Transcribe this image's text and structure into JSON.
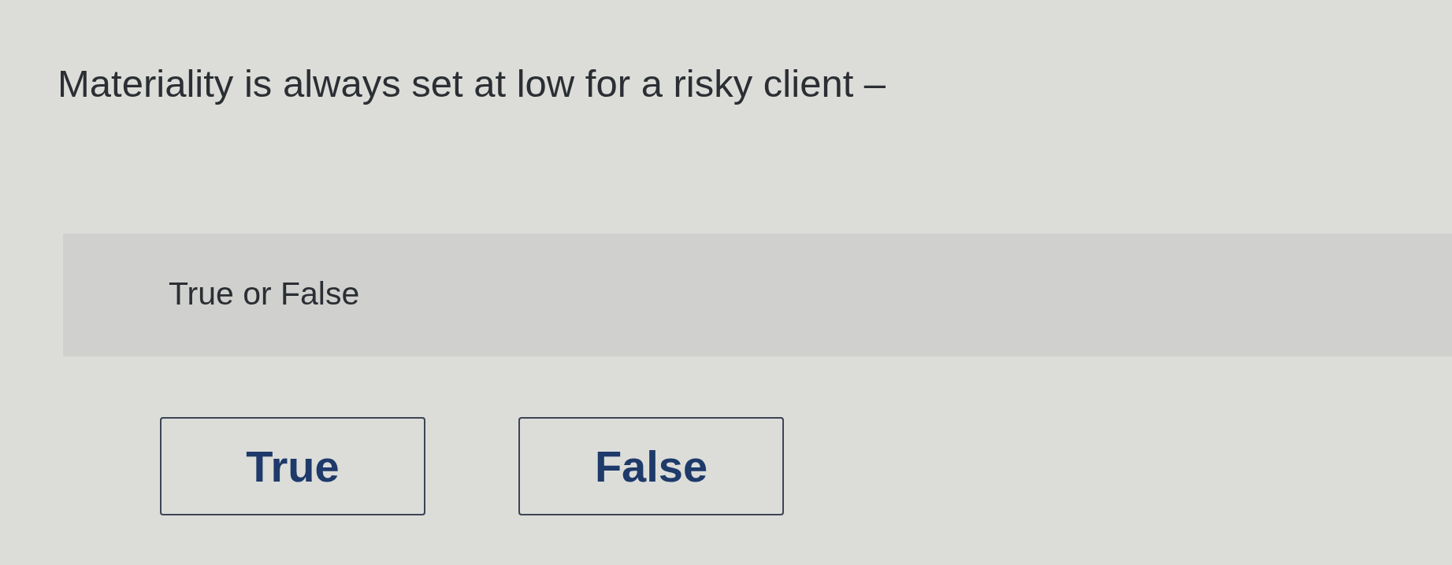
{
  "question": {
    "text": "Materiality is always set at low for a risky client –"
  },
  "prompt": {
    "text": "True or False"
  },
  "options": [
    {
      "label": "True",
      "selected": false
    },
    {
      "label": "False",
      "selected": false
    }
  ]
}
